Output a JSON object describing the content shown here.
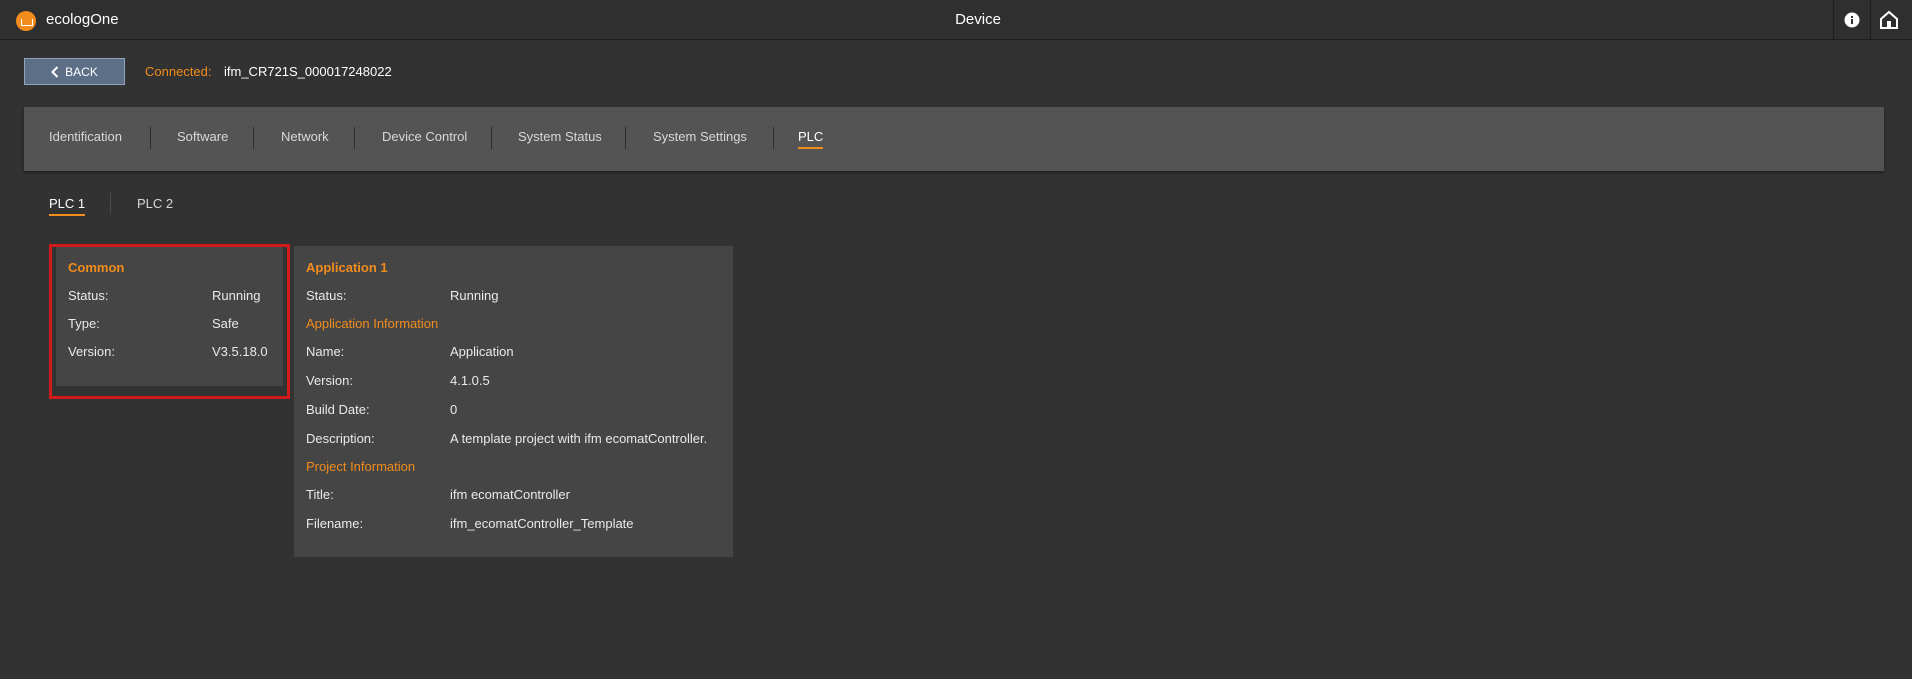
{
  "app": {
    "name": "ecologOne",
    "window_title": "Device"
  },
  "toolbar": {
    "back_label": "BACK"
  },
  "connection": {
    "label": "Connected:",
    "device": "ifm_CR721S_000017248022"
  },
  "tabs": [
    {
      "label": "Identification",
      "active": false
    },
    {
      "label": "Software",
      "active": false
    },
    {
      "label": "Network",
      "active": false
    },
    {
      "label": "Device Control",
      "active": false
    },
    {
      "label": "System Status",
      "active": false
    },
    {
      "label": "System Settings",
      "active": false
    },
    {
      "label": "PLC",
      "active": true
    }
  ],
  "subtabs": [
    {
      "label": "PLC 1",
      "active": true
    },
    {
      "label": "PLC 2",
      "active": false
    }
  ],
  "common": {
    "title": "Common",
    "rows": [
      {
        "label": "Status:",
        "value": "Running"
      },
      {
        "label": "Type:",
        "value": "Safe"
      },
      {
        "label": "Version:",
        "value": "V3.5.18.0"
      }
    ]
  },
  "application": {
    "title": "Application 1",
    "status": {
      "label": "Status:",
      "value": "Running"
    },
    "app_info": {
      "title": "Application Information",
      "rows": [
        {
          "label": "Name:",
          "value": "Application"
        },
        {
          "label": "Version:",
          "value": "4.1.0.5"
        },
        {
          "label": "Build Date:",
          "value": "0"
        },
        {
          "label": "Description:",
          "value": "A template project with ifm ecomatController."
        }
      ]
    },
    "project_info": {
      "title": "Project Information",
      "rows": [
        {
          "label": "Title:",
          "value": "ifm ecomatController"
        },
        {
          "label": "Filename:",
          "value": "ifm_ecomatController_Template"
        }
      ]
    }
  },
  "colors": {
    "accent": "#f28c1c",
    "highlight": "#d11a1a",
    "background": "#323232",
    "panel": "#454545"
  }
}
